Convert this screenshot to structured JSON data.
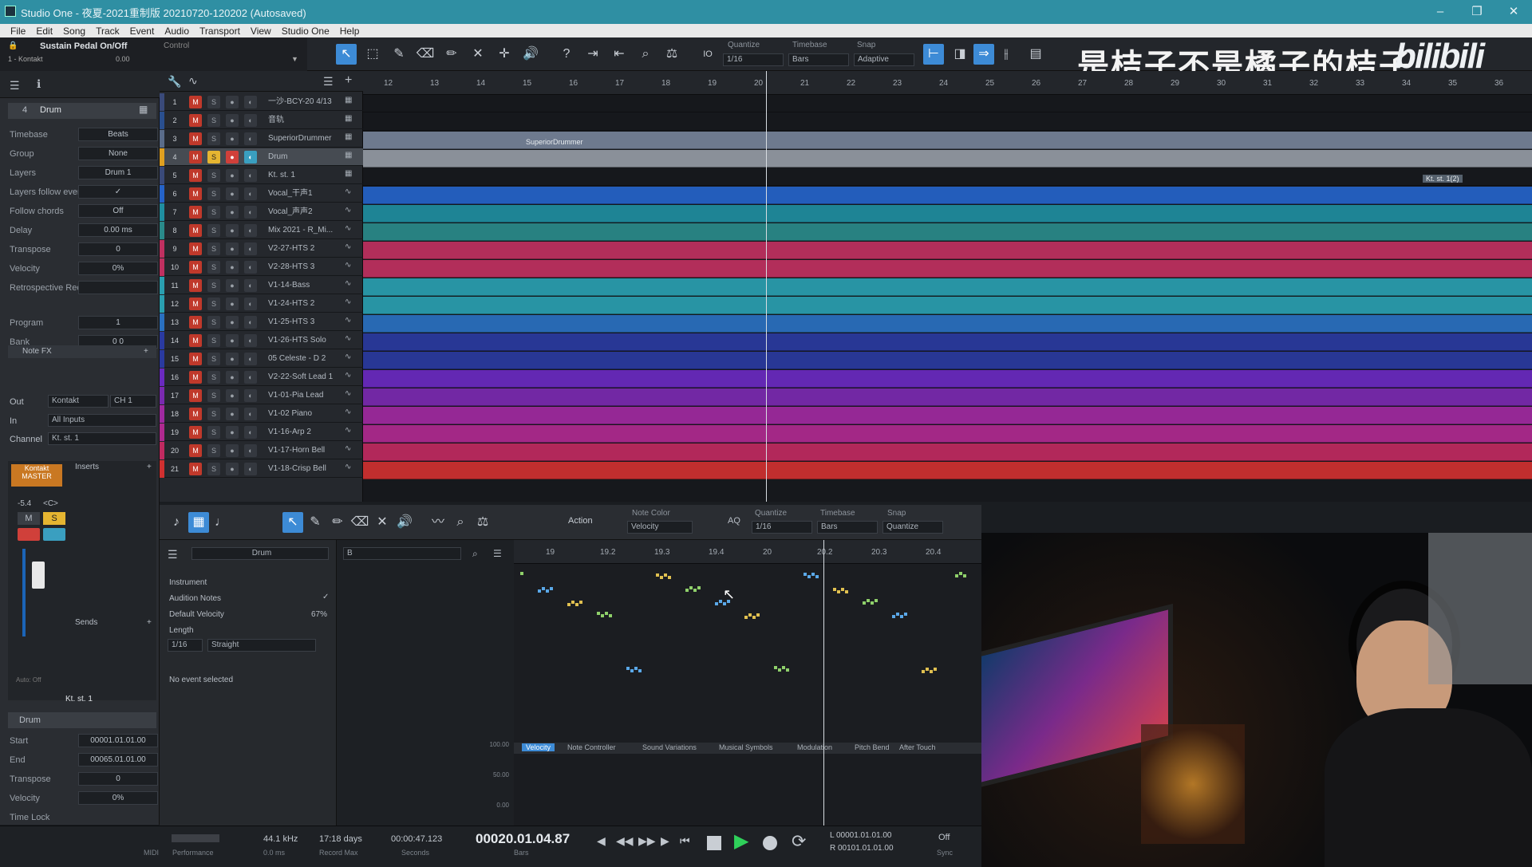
{
  "window": {
    "title": "Studio One - 夜夏-2021重制版 20210720-120202 (Autosaved)",
    "controls": [
      "–",
      "❐",
      "✕"
    ]
  },
  "menu": [
    "File",
    "Edit",
    "Song",
    "Track",
    "Event",
    "Audio",
    "Transport",
    "View",
    "Studio One",
    "Help"
  ],
  "toolbar": {
    "instrument": "Sustain Pedal On/Off",
    "instrument_sub": "1 - Kontakt",
    "value": "0.00",
    "control": "Control",
    "quantize_label": "Quantize",
    "quantize": "1/16",
    "timebase_label": "Timebase",
    "timebase": "Bars",
    "snap_label": "Snap",
    "snap": "Adaptive",
    "io": "IO"
  },
  "watermark": "是桔子不是橘子的桔子",
  "logo": "bilibili",
  "inspector": {
    "track_num": "4",
    "track_name": "Drum",
    "rows": [
      {
        "k": "Timebase",
        "v": "Beats"
      },
      {
        "k": "Group",
        "v": "None"
      },
      {
        "k": "Layers",
        "v": "Drum 1"
      },
      {
        "k": "Layers follow events",
        "v": "✓"
      },
      {
        "k": "Follow chords",
        "v": "Off"
      },
      {
        "k": "Delay",
        "v": "0.00 ms"
      },
      {
        "k": "Transpose",
        "v": "0"
      },
      {
        "k": "Velocity",
        "v": "0%"
      },
      {
        "k": "Retrospective Recording",
        "v": ""
      },
      {
        "k": "Program",
        "v": "1"
      },
      {
        "k": "Bank",
        "v": "0     0"
      }
    ],
    "note_fx": "Note FX",
    "out_label": "Out",
    "out": "Kontakt",
    "out_ch": "CH 1",
    "in_label": "In",
    "in": "All Inputs",
    "channel_label": "Channel",
    "channel": "Kt. st. 1",
    "mixer": {
      "name": "Kontakt",
      "master": "MASTER",
      "level": "-5.4",
      "pan": "<C>",
      "inserts": "Inserts",
      "sends": "Sends",
      "auto": "Auto: Off",
      "ch_name": "Kt. st. 1",
      "m": "M",
      "s": "S"
    },
    "event": {
      "name": "Drum",
      "rows": [
        {
          "k": "Start",
          "v": "00001.01.01.00"
        },
        {
          "k": "End",
          "v": "00065.01.01.00"
        },
        {
          "k": "Transpose",
          "v": "0"
        },
        {
          "k": "Velocity",
          "v": "0%"
        },
        {
          "k": "Time Lock",
          "v": ""
        }
      ]
    }
  },
  "tracks": [
    {
      "n": "1",
      "name": "一沙-BCY-20 4/13",
      "color": "#3a4a7a"
    },
    {
      "n": "2",
      "name": "音轨",
      "color": "#2a4f8f"
    },
    {
      "n": "3",
      "name": "SuperiorDrummer",
      "color": "#5a6c8a"
    },
    {
      "n": "4",
      "name": "Drum",
      "color": "#e0a020"
    },
    {
      "n": "5",
      "name": "Kt. st. 1",
      "color": "#3a4a7a"
    },
    {
      "n": "6",
      "name": "Vocal_干声1",
      "color": "#2563c9"
    },
    {
      "n": "7",
      "name": "Vocal_声声2",
      "color": "#1f8ea0"
    },
    {
      "n": "8",
      "name": "Mix 2021 - R_Mi...",
      "color": "#2a8a8a"
    },
    {
      "n": "9",
      "name": "V2-27-HTS 2",
      "color": "#c03060"
    },
    {
      "n": "10",
      "name": "V2-28-HTS 3",
      "color": "#c03060"
    },
    {
      "n": "11",
      "name": "V1-14-Bass",
      "color": "#2a9fb0"
    },
    {
      "n": "12",
      "name": "V1-24-HTS 2",
      "color": "#2a9fb0"
    },
    {
      "n": "13",
      "name": "V1-25-HTS 3",
      "color": "#2a70c0"
    },
    {
      "n": "14",
      "name": "V1-26-HTS Solo",
      "color": "#2a3aa0"
    },
    {
      "n": "15",
      "name": "05 Celeste - D 2",
      "color": "#2a3aa0"
    },
    {
      "n": "16",
      "name": "V2-22-Soft Lead 1",
      "color": "#6a2ac0"
    },
    {
      "n": "17",
      "name": "V1-01-Pia Lead",
      "color": "#7a2ab0"
    },
    {
      "n": "18",
      "name": "V1-02 Piano",
      "color": "#a02aa0"
    },
    {
      "n": "19",
      "name": "V1-16-Arp 2",
      "color": "#b02a90"
    },
    {
      "n": "20",
      "name": "V1-17-Horn Bell",
      "color": "#c02a60"
    },
    {
      "n": "21",
      "name": "V1-18-Crisp Bell",
      "color": "#d03030"
    }
  ],
  "ruler": [
    "12",
    "13",
    "14",
    "15",
    "16",
    "17",
    "18",
    "19",
    "20",
    "21",
    "22",
    "23",
    "24",
    "25",
    "26",
    "27",
    "28",
    "29",
    "30",
    "31",
    "32",
    "33",
    "34",
    "35",
    "36"
  ],
  "clips": {
    "superior": "SuperiorDrummer",
    "kt": "Kt. st. 1(2)"
  },
  "editor": {
    "action": "Action",
    "note_color_label": "Note Color",
    "note_color": "Velocity",
    "aq": "AQ",
    "quantize_label": "Quantize",
    "quantize": "1/16",
    "timebase_label": "Timebase",
    "timebase": "Bars",
    "snap_label": "Snap",
    "snap": "Quantize",
    "track": "Drum",
    "instrument": "Instrument",
    "audition": "Audition Notes",
    "default_velocity": "Default Velocity",
    "default_velocity_val": "67%",
    "length": "Length",
    "length_val": "1/16",
    "straight": "Straight",
    "no_event": "No event selected",
    "key": "B",
    "ruler": [
      "19",
      "19.2",
      "19.3",
      "19.4",
      "20",
      "20.2",
      "20.3",
      "20.4"
    ],
    "lanes": [
      "Velocity",
      "Note Controller",
      "Sound Variations",
      "Musical Symbols",
      "Modulation",
      "Pitch Bend",
      "After Touch"
    ],
    "vel_scale": [
      "100.00",
      "50.00",
      "0.00"
    ]
  },
  "transport": {
    "midi": "MIDI",
    "performance": "Performance",
    "rate": "44.1 kHz",
    "latency": "0.0 ms",
    "record_max": "17:18 days",
    "record_max_label": "Record Max",
    "seconds": "00:00:47.123",
    "seconds_label": "Seconds",
    "bars": "00020.01.04.87",
    "bars_label": "Bars",
    "loop_l": "L 00001.01.01.00",
    "loop_r": "R 00101.01.01.00",
    "sync": "Off",
    "sync_label": "Sync"
  }
}
